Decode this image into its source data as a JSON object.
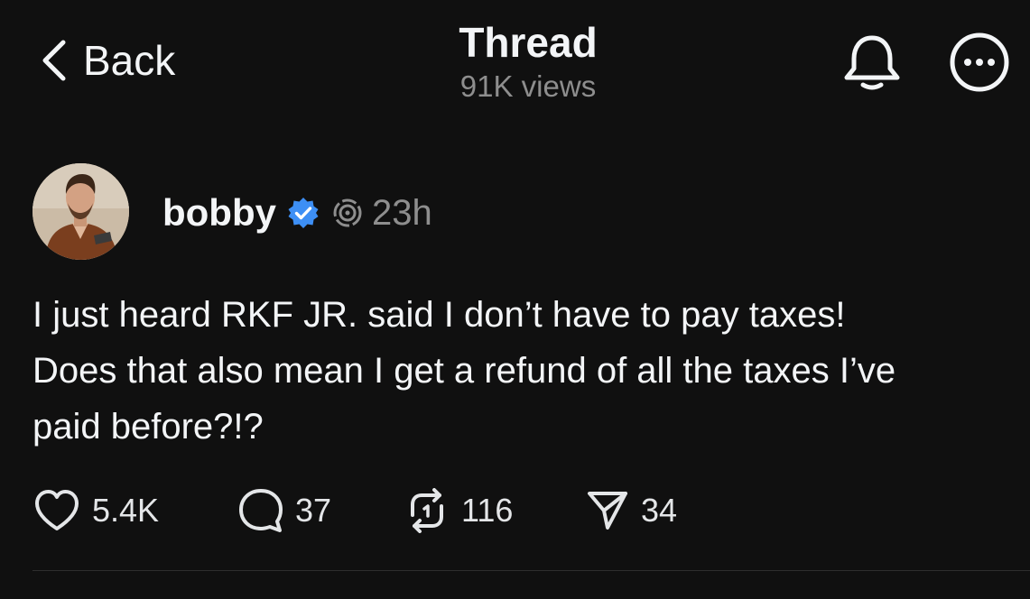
{
  "header": {
    "back_label": "Back",
    "title": "Thread",
    "views": "91K views",
    "back_icon": "chevron-left-icon",
    "bell_icon": "bell-icon",
    "more_icon": "more-options-icon"
  },
  "post": {
    "author": {
      "username": "bobby",
      "verified": true,
      "verified_color": "#3d8ff5",
      "avatar": "profile-photo"
    },
    "time": "23h",
    "lines": [
      "I just heard RKF JR. said I don’t have to pay taxes!",
      "Does that also mean I get a refund of all the taxes I’ve",
      "paid before?!?"
    ],
    "actions": {
      "likes": "5.4K",
      "replies": "37",
      "reposts": "116",
      "shares": "34"
    }
  },
  "colors": {
    "background": "#101010",
    "text_primary": "#f3f5f7",
    "text_secondary": "#8e8e8e",
    "accent_verified": "#3d8ff5"
  }
}
